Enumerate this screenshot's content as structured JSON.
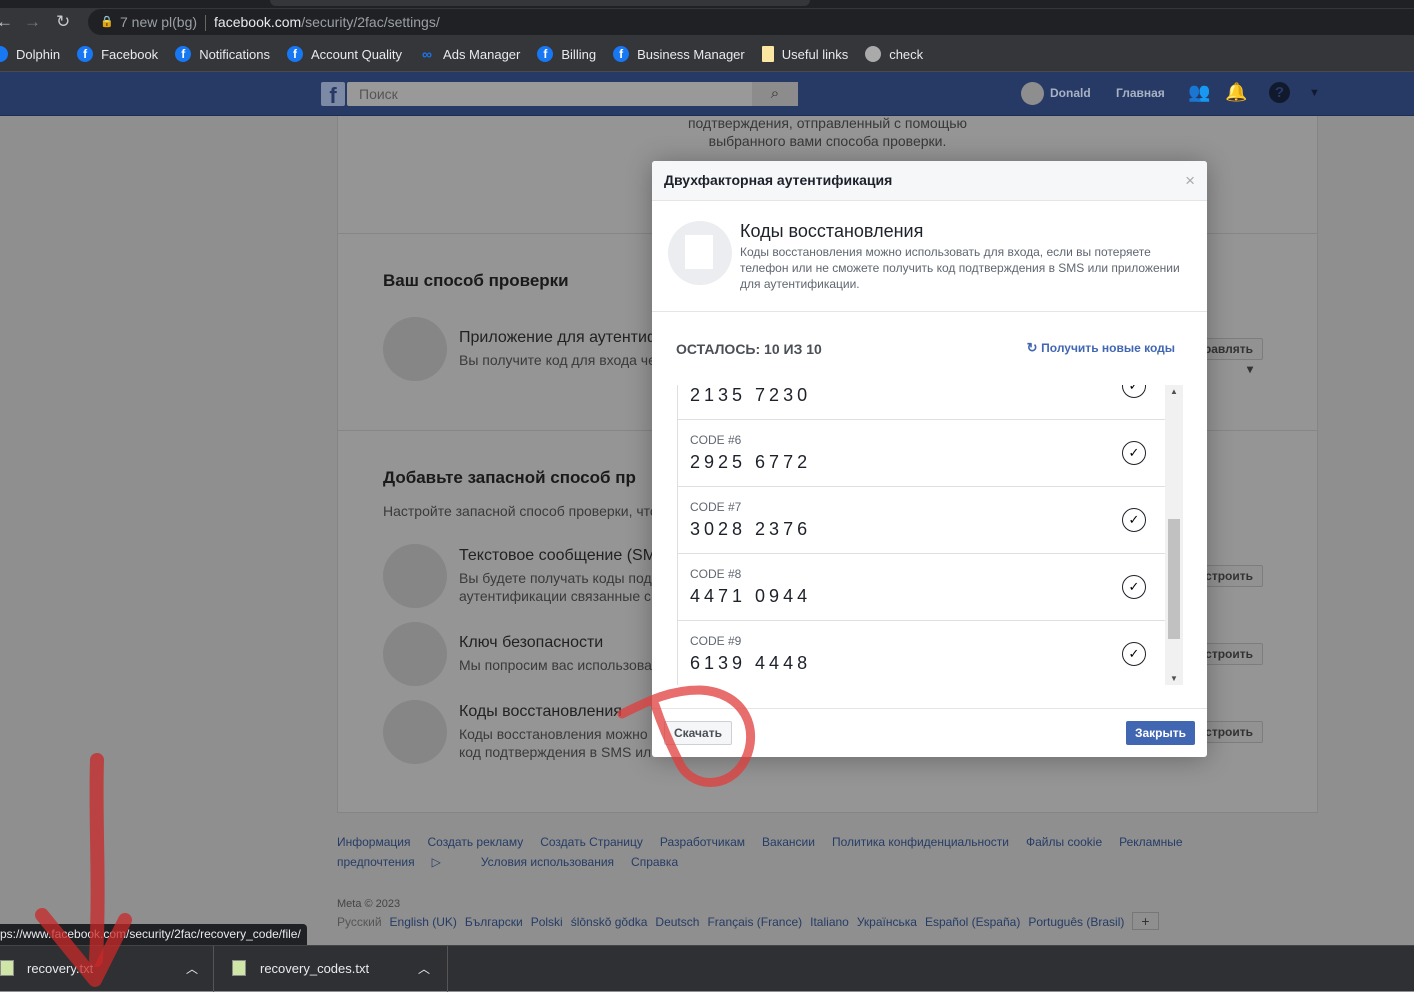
{
  "browser": {
    "tab_hint": "7 new pl(bg)",
    "url_host": "facebook.com",
    "url_path": "/security/2fac/settings/",
    "bookmarks": [
      {
        "label": "Dolphin",
        "icon": "dolphin-icon"
      },
      {
        "label": "Facebook",
        "icon": "facebook-icon"
      },
      {
        "label": "Notifications",
        "icon": "facebook-icon"
      },
      {
        "label": "Account Quality",
        "icon": "facebook-icon"
      },
      {
        "label": "Ads Manager",
        "icon": "meta-icon"
      },
      {
        "label": "Billing",
        "icon": "facebook-icon"
      },
      {
        "label": "Business Manager",
        "icon": "facebook-icon"
      },
      {
        "label": "Useful links",
        "icon": "folder-icon"
      },
      {
        "label": "check",
        "icon": "globe-icon"
      }
    ],
    "status_url": "ps://www.facebook.com/security/2fac/recovery_code/file/",
    "downloads": [
      "recovery.txt",
      "recovery_codes.txt"
    ]
  },
  "fb": {
    "search_placeholder": "Поиск",
    "user": "Donald",
    "home": "Главная"
  },
  "page": {
    "top_text_1": "подтверждения, отправленный с помощью",
    "top_text_2": "выбранного вами способа проверки.",
    "section1": {
      "title": "Ваш способ проверки",
      "item_title": "Приложение для аутентиф",
      "item_sub": "Вы получите код для входа че",
      "button": "Управлять ▾"
    },
    "section2": {
      "title": "Добавьте запасной способ пр",
      "subtitle": "Настройте запасной способ проверки, что",
      "items": [
        {
          "title": "Текстовое сообщение (SM",
          "sub1": "Вы будете получать коды под",
          "sub2": "аутентификации связанные с",
          "button": "Настроить"
        },
        {
          "title": "Ключ безопасности",
          "sub1": "Мы попросим вас использова",
          "sub2": "",
          "button": "Настроить"
        },
        {
          "title": "Коды восстановления",
          "sub1": "Коды восстановления можно",
          "sub2": "код подтверждения в SMS ил",
          "button": "Настроить"
        }
      ]
    }
  },
  "footer": {
    "links": [
      "Информация",
      "Создать рекламу",
      "Создать Страницу",
      "Разработчикам",
      "Вакансии",
      "Политика конфиденциальности",
      "Файлы cookie",
      "Рекламные предпочтения",
      "Условия использования",
      "Справка"
    ],
    "copyright": "Meta © 2023",
    "languages": [
      "Русский",
      "English (UK)",
      "Български",
      "Polski",
      "ślōnskŏ gŏdka",
      "Deutsch",
      "Français (France)",
      "Italiano",
      "Українська",
      "Español (España)",
      "Português (Brasil)"
    ],
    "more": "+"
  },
  "modal": {
    "title": "Двухфакторная аутентификация",
    "close": "×",
    "intro_title": "Коды восстановления",
    "intro_desc": "Коды восстановления можно использовать для входа, если вы потеряете телефон или не сможете получить код подтверждения в SMS или приложении для аутентификации.",
    "remaining": "ОСТАЛОСЬ: 10 ИЗ 10",
    "get_new": "Получить новые коды",
    "codes": [
      {
        "label": "",
        "value": "2135 7230"
      },
      {
        "label": "CODE #6",
        "value": "2925 6772"
      },
      {
        "label": "CODE #7",
        "value": "3028 2376"
      },
      {
        "label": "CODE #8",
        "value": "4471 0944"
      },
      {
        "label": "CODE #9",
        "value": "6139 4448"
      }
    ],
    "download": "Скачать",
    "close_button": "Закрыть"
  },
  "colors": {
    "fb_blue": "#4267b2",
    "annotation_red": "#e03c3c"
  }
}
